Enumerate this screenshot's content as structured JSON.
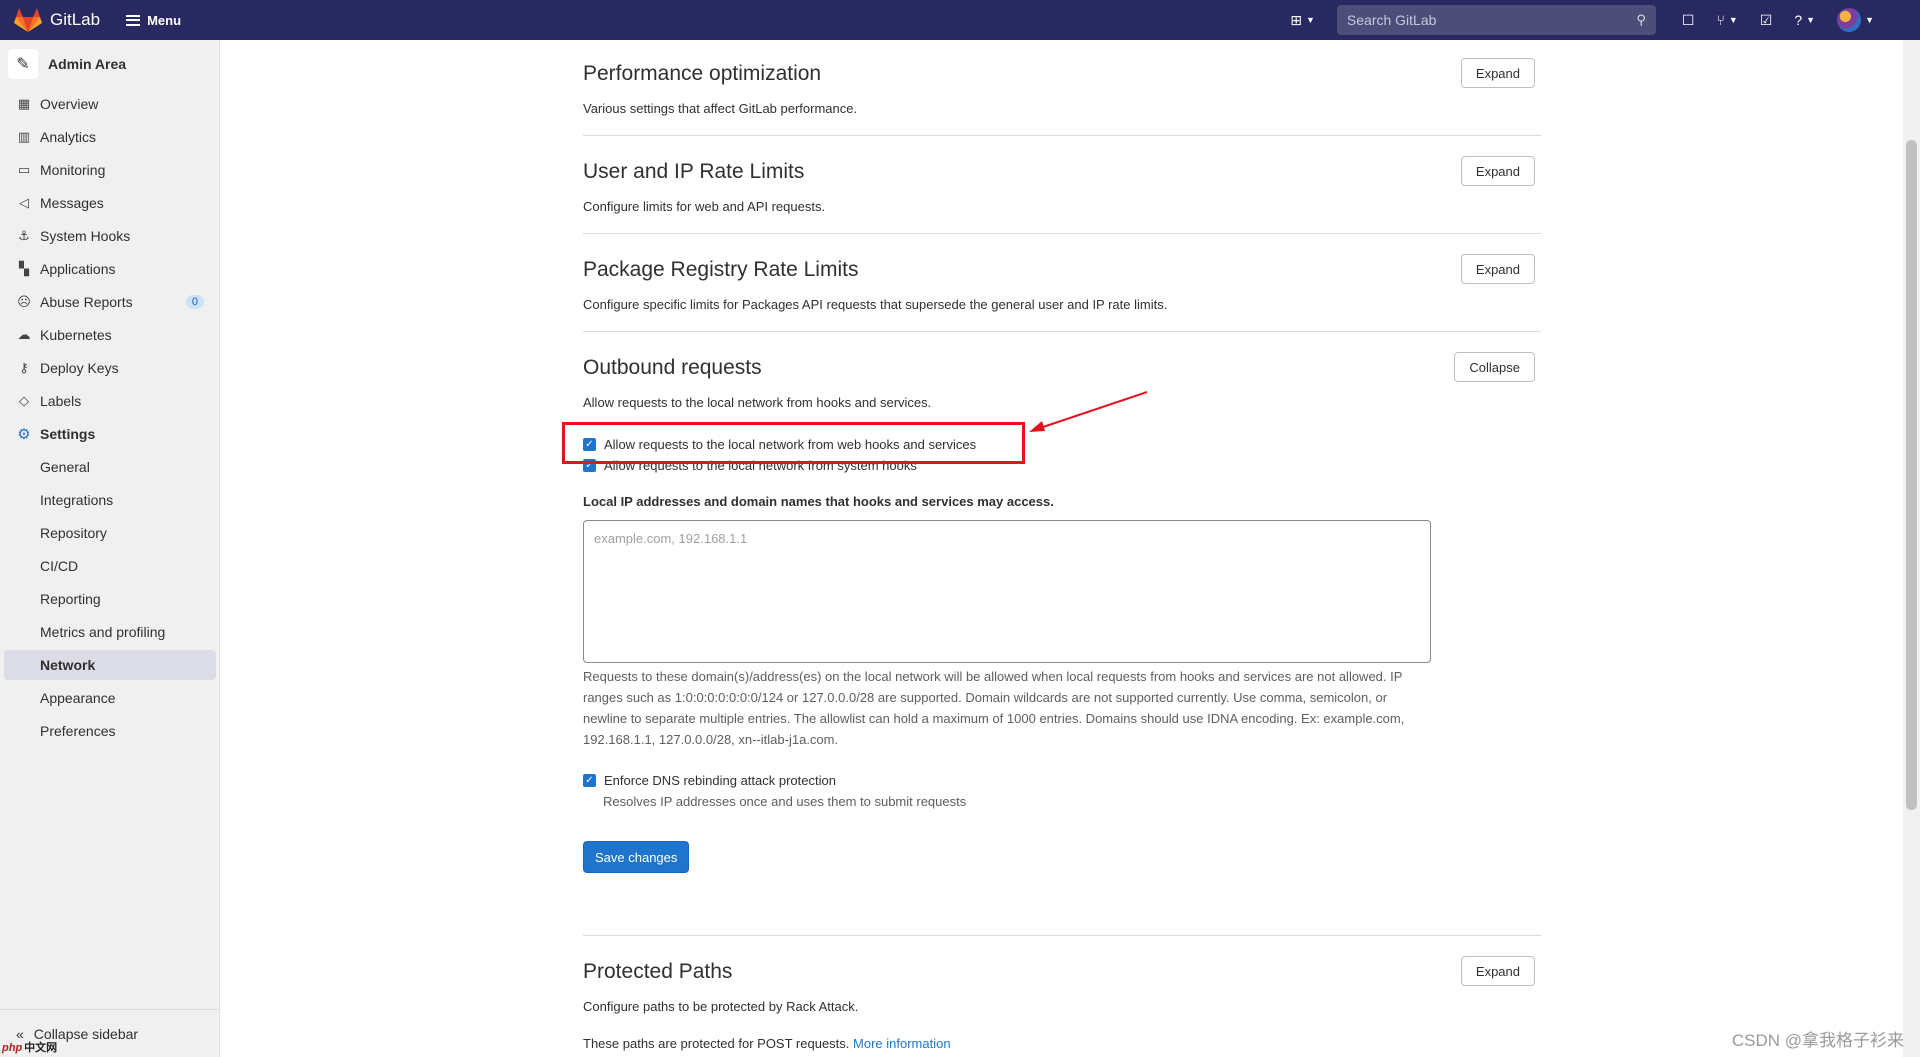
{
  "topbar": {
    "app_name": "GitLab",
    "menu_label": "Menu",
    "search_placeholder": "Search GitLab"
  },
  "sidebar": {
    "title": "Admin Area",
    "items": [
      {
        "label": "Overview",
        "icon": "overview-icon"
      },
      {
        "label": "Analytics",
        "icon": "analytics-icon"
      },
      {
        "label": "Monitoring",
        "icon": "monitoring-icon"
      },
      {
        "label": "Messages",
        "icon": "messages-icon"
      },
      {
        "label": "System Hooks",
        "icon": "hooks-icon"
      },
      {
        "label": "Applications",
        "icon": "applications-icon"
      },
      {
        "label": "Abuse Reports",
        "icon": "abuse-icon",
        "badge": "0"
      },
      {
        "label": "Kubernetes",
        "icon": "kubernetes-icon"
      },
      {
        "label": "Deploy Keys",
        "icon": "key-icon"
      },
      {
        "label": "Labels",
        "icon": "label-icon"
      },
      {
        "label": "Settings",
        "icon": "settings-icon"
      }
    ],
    "settings_sub": [
      {
        "label": "General"
      },
      {
        "label": "Integrations"
      },
      {
        "label": "Repository"
      },
      {
        "label": "CI/CD"
      },
      {
        "label": "Reporting"
      },
      {
        "label": "Metrics and profiling"
      },
      {
        "label": "Network",
        "active": true
      },
      {
        "label": "Appearance"
      },
      {
        "label": "Preferences"
      }
    ],
    "collapse_label": "Collapse sidebar"
  },
  "sections": {
    "perf": {
      "title": "Performance optimization",
      "desc": "Various settings that affect GitLab performance.",
      "button": "Expand"
    },
    "rate": {
      "title": "User and IP Rate Limits",
      "desc": "Configure limits for web and API requests.",
      "button": "Expand"
    },
    "pkg": {
      "title": "Package Registry Rate Limits",
      "desc": "Configure specific limits for Packages API requests that supersede the general user and IP rate limits.",
      "button": "Expand"
    },
    "outbound": {
      "title": "Outbound requests",
      "desc": "Allow requests to the local network from hooks and services.",
      "button": "Collapse",
      "cb_webhooks": "Allow requests to the local network from web hooks and services",
      "cb_system": "Allow requests to the local network from system hooks",
      "allowlist_label": "Local IP addresses and domain names that hooks and services may access.",
      "allowlist_placeholder": "example.com, 192.168.1.1",
      "allowlist_help": "Requests to these domain(s)/address(es) on the local network will be allowed when local requests from hooks and services are not allowed. IP ranges such as 1:0:0:0:0:0:0:0/124 or 127.0.0.0/28 are supported. Domain wildcards are not supported currently. Use comma, semicolon, or newline to separate multiple entries. The allowlist can hold a maximum of 1000 entries. Domains should use IDNA encoding. Ex: example.com, 192.168.1.1, 127.0.0.0/28, xn--itlab-j1a.com.",
      "cb_dns": "Enforce DNS rebinding attack protection",
      "dns_help": "Resolves IP addresses once and uses them to submit requests",
      "save": "Save changes"
    },
    "protected": {
      "title": "Protected Paths",
      "desc": "Configure paths to be protected by Rack Attack.",
      "button": "Expand",
      "note": "These paths are protected for POST requests.",
      "link": "More information"
    }
  },
  "watermark": "CSDN @拿我格子衫来",
  "php_logo": "php",
  "php_logo_text": "中文网",
  "colors": {
    "navbar": "#292961",
    "accent": "#1f75cb",
    "highlight": "#e8121a"
  }
}
